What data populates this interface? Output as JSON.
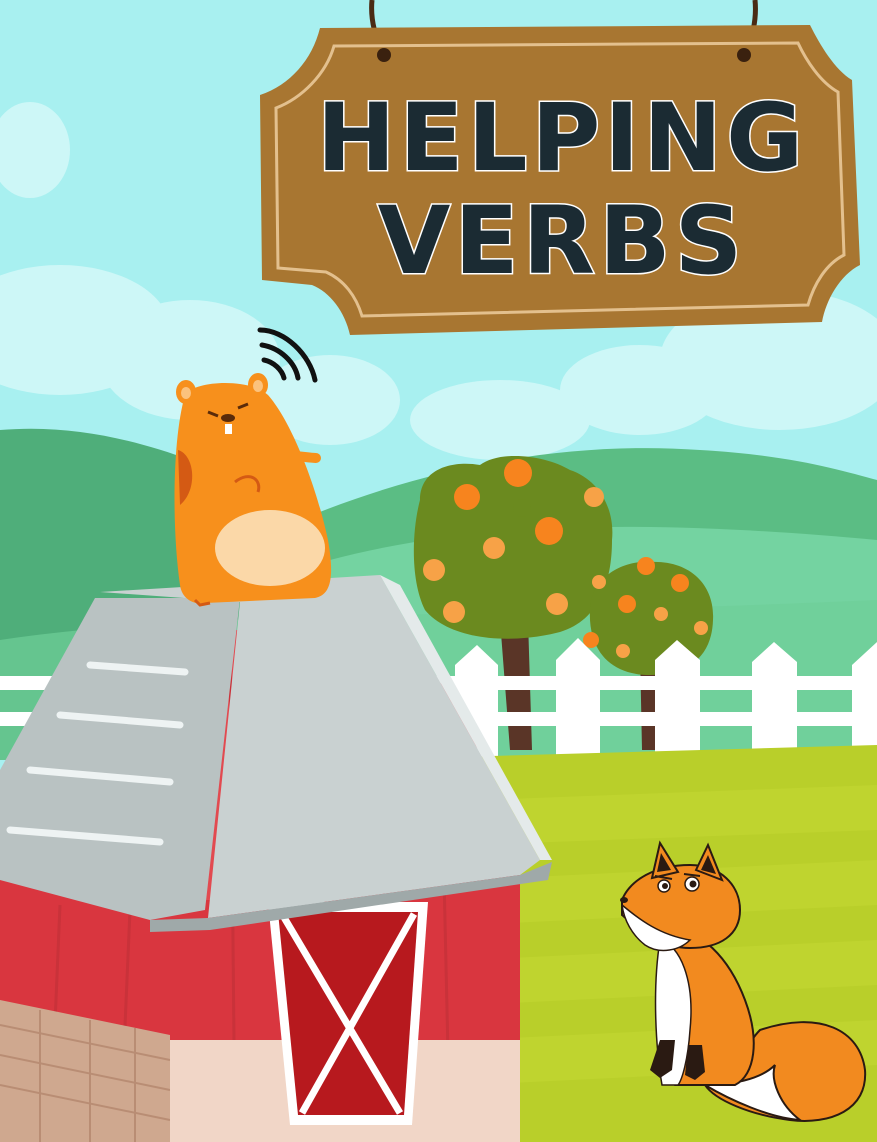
{
  "cover": {
    "title_line1": "HELPING",
    "title_line2": "VERBS"
  },
  "palette": {
    "sky": "#a8f0f0",
    "hill_dark": "#4fae7a",
    "hill_light": "#74d3a1",
    "grass": "#b9cf2a",
    "barn_red": "#e24a50",
    "roof_gray": "#c9d1d1",
    "sign_wood": "#a87631",
    "title_text": "#1b2b33",
    "hamster_orange": "#f7901c",
    "fox_orange": "#f28a1f"
  }
}
